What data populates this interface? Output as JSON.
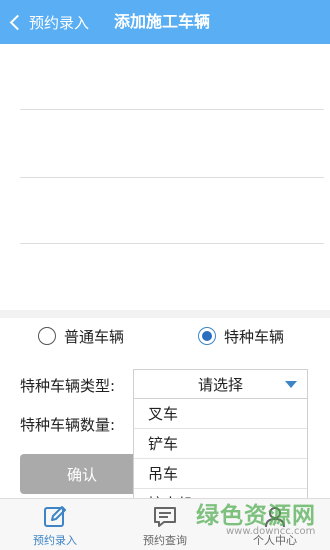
{
  "header": {
    "back_label": "预约录入",
    "title": "添加施工车辆",
    "bg_color": "#5aaef3"
  },
  "vehicle_kind": {
    "options": [
      {
        "label": "普通车辆",
        "checked": false
      },
      {
        "label": "特种车辆",
        "checked": true
      }
    ]
  },
  "special_type": {
    "label": "特种车辆类型:",
    "selected": "请选择",
    "dropdown_options": [
      "叉车",
      "铲车",
      "吊车",
      "挖土机"
    ]
  },
  "special_count": {
    "label": "特种车辆数量:"
  },
  "confirm_label": "确认",
  "tabbar": {
    "tabs": [
      {
        "label": "预约录入",
        "icon": "edit-icon",
        "active": true
      },
      {
        "label": "预约查询",
        "icon": "message-icon",
        "active": false
      },
      {
        "label": "个人中心",
        "icon": "user-icon",
        "active": false
      }
    ]
  },
  "watermark": {
    "text": "绿色资源网",
    "url": "www.downcc.com"
  },
  "accent_color": "#3d85c6"
}
